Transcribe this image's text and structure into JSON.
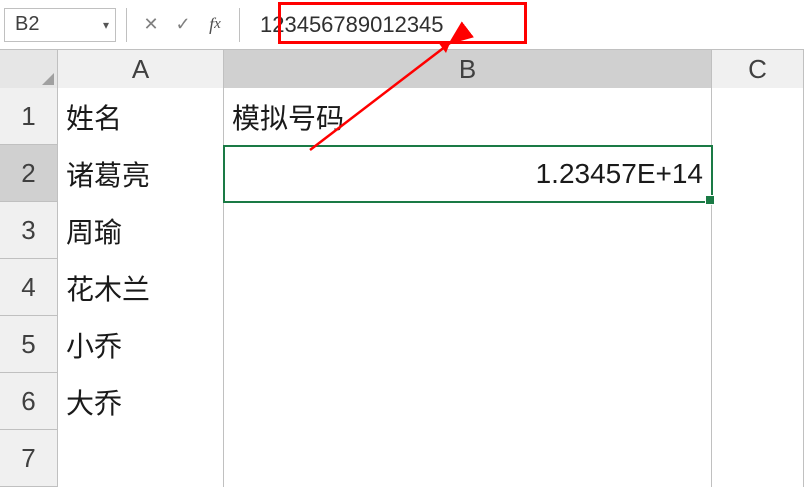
{
  "formula_bar": {
    "name_box": "B2",
    "formula_content": "123456789012345"
  },
  "columns": [
    "A",
    "B",
    "C"
  ],
  "active_column_index": 1,
  "active_row_index": 1,
  "rows": [
    {
      "num": "1",
      "A": "姓名",
      "B": "模拟号码"
    },
    {
      "num": "2",
      "A": "诸葛亮",
      "B": "1.23457E+14"
    },
    {
      "num": "3",
      "A": "周瑜",
      "B": ""
    },
    {
      "num": "4",
      "A": "花木兰",
      "B": ""
    },
    {
      "num": "5",
      "A": "小乔",
      "B": ""
    },
    {
      "num": "6",
      "A": "大乔",
      "B": ""
    },
    {
      "num": "7",
      "A": "",
      "B": ""
    }
  ],
  "annotation": {
    "box_color": "#ff0000",
    "arrow_color": "#ff0000"
  }
}
